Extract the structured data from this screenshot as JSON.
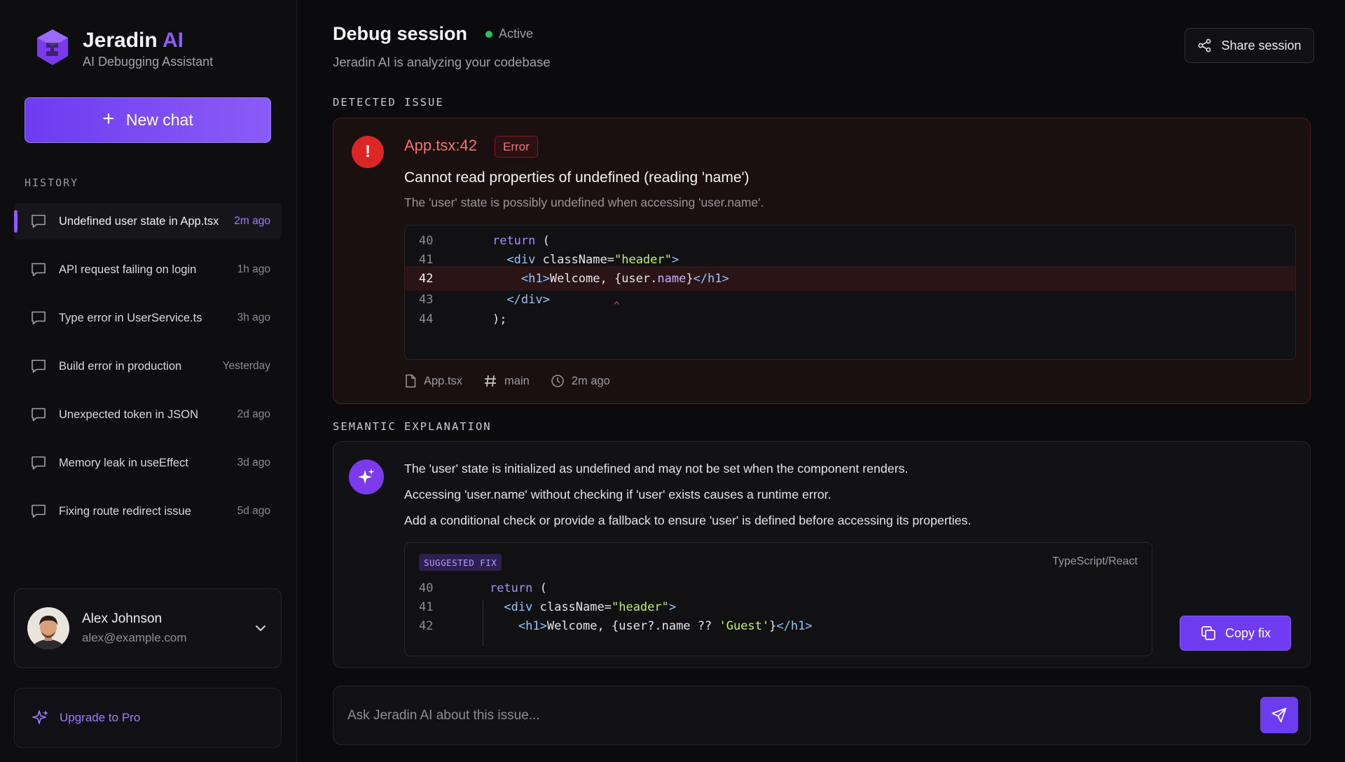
{
  "colors": {
    "accent": "#8b5cf6",
    "error": "#f87171",
    "status_active": "#22c55e",
    "background": "#0b0b0d"
  },
  "sidebar": {
    "brand_name": "Jeradin",
    "brand_name_accent": "AI",
    "brand_subtitle": "AI Debugging Assistant",
    "new_chat_label": "New chat",
    "history_label": "HISTORY",
    "items": [
      {
        "title": "Undefined user state in App.tsx",
        "time": "2m ago",
        "active": true
      },
      {
        "title": "API request failing on login",
        "time": "1h ago"
      },
      {
        "title": "Type error in UserService.ts",
        "time": "3h ago"
      },
      {
        "title": "Build error in production",
        "time": "Yesterday"
      },
      {
        "title": "Unexpected token in JSON",
        "time": "2d ago"
      },
      {
        "title": "Memory leak in useEffect",
        "time": "3d ago"
      },
      {
        "title": "Fixing route redirect issue",
        "time": "5d ago"
      }
    ],
    "user": {
      "name": "Alex Johnson",
      "email": "alex@example.com"
    },
    "upgrade_label": "Upgrade to Pro"
  },
  "header": {
    "title": "Debug session",
    "status": "Active",
    "subtitle": "Jeradin AI is analyzing your codebase",
    "share_label": "Share session"
  },
  "issue": {
    "section_label": "DETECTED ISSUE",
    "file_ref": "App.tsx:42",
    "badge": "Error",
    "title": "Cannot read properties of undefined (reading 'name')",
    "description": "The 'user' state is possibly undefined when accessing 'user.name'.",
    "code": [
      {
        "ln": "40",
        "tokens": [
          [
            "    ",
            "txt"
          ],
          [
            "return",
            "kw"
          ],
          [
            " (",
            "txt"
          ]
        ]
      },
      {
        "ln": "41",
        "tokens": [
          [
            "      ",
            "txt"
          ],
          [
            "<div ",
            "tag"
          ],
          [
            "className",
            "txt"
          ],
          [
            "=",
            "txt"
          ],
          [
            "\"header\"",
            "str"
          ],
          [
            ">",
            "tag"
          ]
        ]
      },
      {
        "ln": "42",
        "tokens": [
          [
            "        ",
            "txt"
          ],
          [
            "<h1>",
            "tag"
          ],
          [
            "Welcome, {user.",
            "txt"
          ],
          [
            "name",
            "prop"
          ],
          [
            "}",
            "txt"
          ],
          [
            "</h1>",
            "tag"
          ]
        ],
        "highlight": true
      },
      {
        "ln": "43",
        "tokens": [
          [
            "      ",
            "txt"
          ],
          [
            "</div>",
            "tag"
          ]
        ]
      },
      {
        "ln": "44",
        "tokens": [
          [
            "    ",
            "txt"
          ],
          [
            ");",
            "txt"
          ]
        ]
      }
    ],
    "caret": "^",
    "meta": {
      "file": "App.tsx",
      "branch": "main",
      "time": "2m ago"
    }
  },
  "explanation": {
    "section_label": "SEMANTIC EXPLANATION",
    "lines": [
      "The 'user' state is initialized as undefined and may not be set when the component renders.",
      "Accessing 'user.name' without checking if 'user' exists causes a runtime error.",
      "Add a conditional check or provide a fallback to ensure 'user' is defined before accessing its properties."
    ],
    "fix_badge": "SUGGESTED FIX",
    "fix_language": "TypeScript/React",
    "fix_code": [
      {
        "ln": "40",
        "tokens": [
          [
            "    ",
            "txt"
          ],
          [
            "return",
            "kw"
          ],
          [
            " (",
            "txt"
          ]
        ]
      },
      {
        "ln": "41",
        "tokens": [
          [
            "      ",
            "txt"
          ],
          [
            "<div ",
            "tag"
          ],
          [
            "className",
            "txt"
          ],
          [
            "=",
            "txt"
          ],
          [
            "\"header\"",
            "str"
          ],
          [
            ">",
            "tag"
          ]
        ]
      },
      {
        "ln": "42",
        "tokens": [
          [
            "        ",
            "txt"
          ],
          [
            "<h1>",
            "tag"
          ],
          [
            "Welcome, {user?.name ?? ",
            "txt"
          ],
          [
            "'Guest'",
            "str"
          ],
          [
            "}",
            "txt"
          ],
          [
            "</h1>",
            "tag"
          ]
        ]
      }
    ],
    "copy_label": "Copy fix"
  },
  "ask": {
    "placeholder": "Ask Jeradin AI about this issue..."
  }
}
